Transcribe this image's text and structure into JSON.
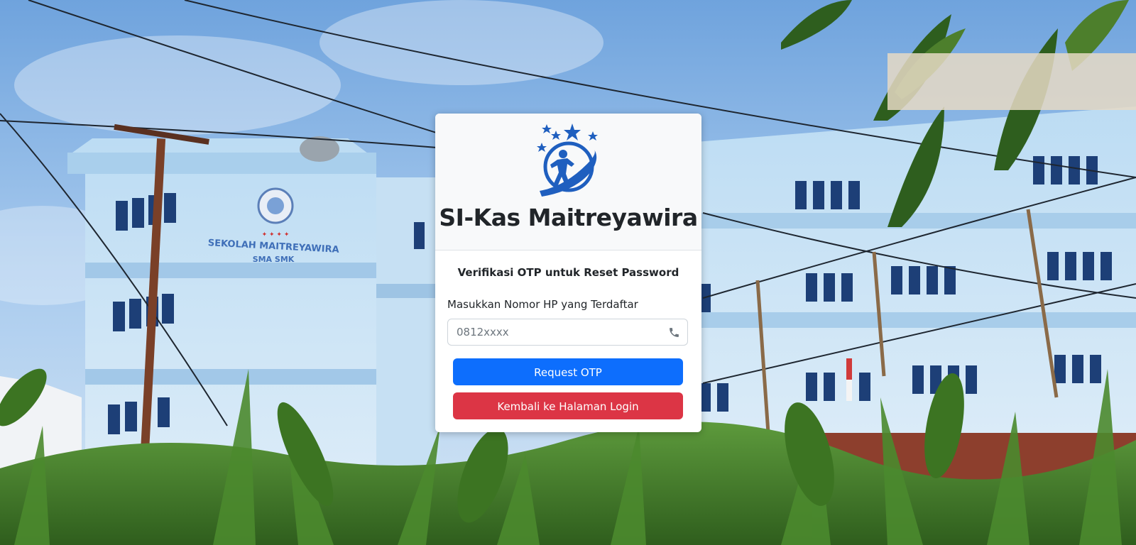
{
  "app": {
    "title": "SI-Kas Maitreyawira"
  },
  "background": {
    "sign_text_line1": "SEKOLAH MAITREYAWIRA",
    "sign_text_line2": "SMA SMK",
    "sky_color": "#8ab7e6",
    "building_color": "#c9e2f4",
    "foliage_color": "#3f7a2a"
  },
  "form": {
    "heading": "Verifikasi OTP untuk Reset Password",
    "phone_label": "Masukkan Nomor HP yang Terdaftar",
    "phone_placeholder": "0812xxxx",
    "phone_value": "",
    "phone_icon": "phone-icon",
    "request_otp_label": "Request OTP",
    "back_to_login_label": "Kembali ke Halaman Login"
  },
  "colors": {
    "primary": "#0d6efd",
    "danger": "#dc3545",
    "logo_blue": "#1f5fbf"
  }
}
